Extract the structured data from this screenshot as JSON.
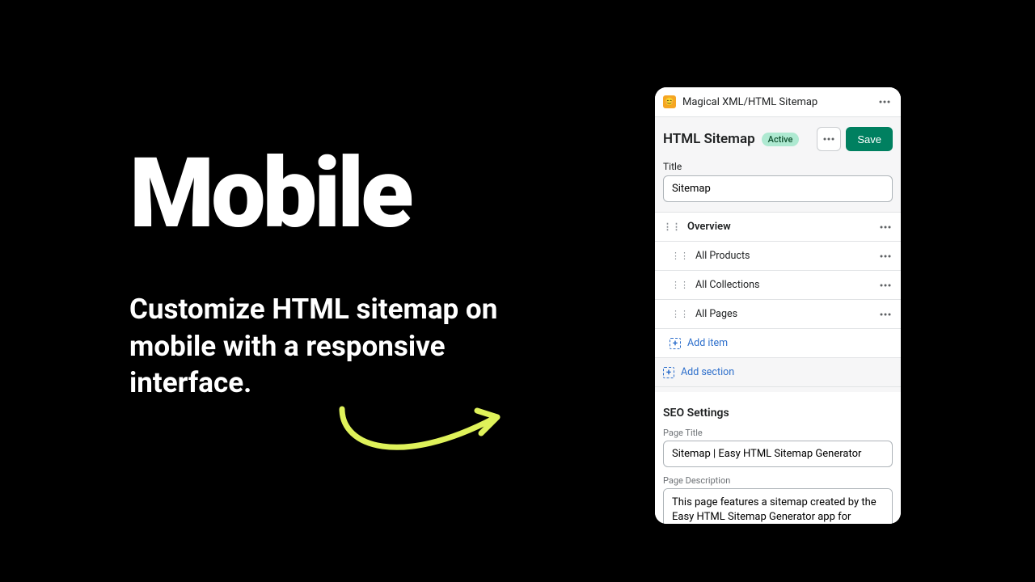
{
  "hero": {
    "headline": "Mobile",
    "subtext": "Customize HTML sitemap on mobile with a responsive interface."
  },
  "app": {
    "logo_emoji": "😊",
    "title": "Magical XML/HTML Sitemap"
  },
  "header": {
    "heading": "HTML Sitemap",
    "status": "Active",
    "save_label": "Save"
  },
  "title_field": {
    "label": "Title",
    "value": "Sitemap"
  },
  "sections": {
    "overview": "Overview",
    "items": [
      "All Products",
      "All Collections",
      "All Pages"
    ],
    "add_item": "Add item",
    "add_section": "Add section"
  },
  "seo": {
    "heading": "SEO Settings",
    "page_title_label": "Page Title",
    "page_title_value": "Sitemap | Easy HTML Sitemap Generator",
    "page_desc_label": "Page Description",
    "page_desc_value": "This page features a sitemap created by the Easy HTML Sitemap Generator app for Shopify."
  }
}
